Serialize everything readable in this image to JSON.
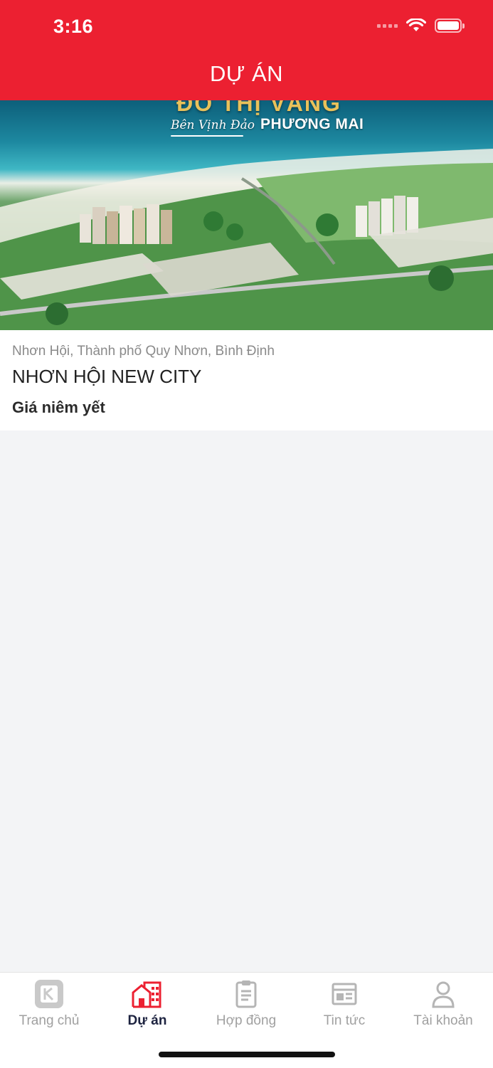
{
  "status_bar": {
    "time": "3:16"
  },
  "header": {
    "title": "DỰ ÁN"
  },
  "project": {
    "banner": {
      "headline": "ĐÔ THỊ VÀNG",
      "sub_script": "Bên Vịnh Đảo",
      "sub_main": "PHƯƠNG MAI"
    },
    "location": "Nhơn Hội, Thành phố Quy Nhơn, Bình Định",
    "name": "NHƠN HỘI NEW CITY",
    "price_label": "Giá niêm yết"
  },
  "tabbar": {
    "active": "Dự án",
    "tabs": [
      {
        "label": "Trang chủ",
        "icon": "home-logo-icon"
      },
      {
        "label": "Dự án",
        "icon": "buildings-icon"
      },
      {
        "label": "Hợp đồng",
        "icon": "clipboard-icon"
      },
      {
        "label": "Tin tức",
        "icon": "newspaper-icon"
      },
      {
        "label": "Tài khoản",
        "icon": "user-icon"
      }
    ]
  },
  "colors": {
    "brand_red": "#ec2031",
    "tab_active": "#1d2340",
    "tab_inactive": "#a0a0a0"
  }
}
